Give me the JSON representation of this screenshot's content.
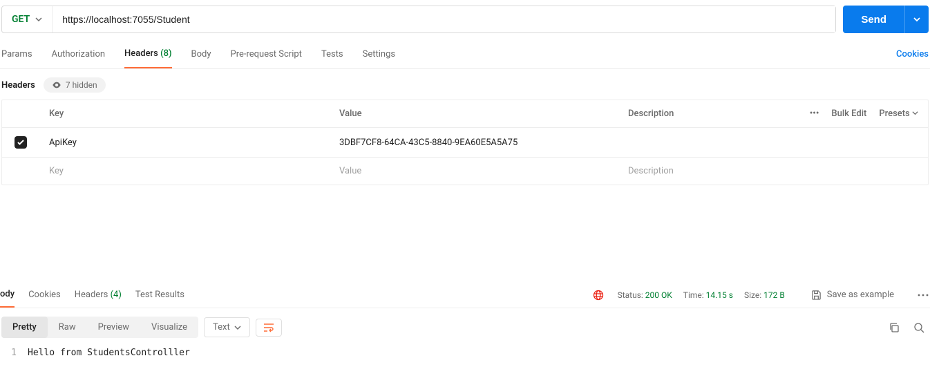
{
  "request": {
    "method": "GET",
    "url": "https://localhost:7055/Student",
    "send_label": "Send"
  },
  "tabs": {
    "params": "Params",
    "auth": "Authorization",
    "headers": "Headers",
    "headers_count": "(8)",
    "body": "Body",
    "prerequest": "Pre-request Script",
    "tests": "Tests",
    "settings": "Settings",
    "cookies": "Cookies"
  },
  "headers_section": {
    "title": "Headers",
    "hidden_label": "7 hidden",
    "col_key": "Key",
    "col_value": "Value",
    "col_desc": "Description",
    "more": "•••",
    "bulk": "Bulk Edit",
    "presets": "Presets",
    "rows": [
      {
        "key": "ApiKey",
        "value": "3DBF7CF8-64CA-43C5-8840-9EA60E5A5A75",
        "desc": ""
      }
    ],
    "ph_key": "Key",
    "ph_value": "Value",
    "ph_desc": "Description"
  },
  "response": {
    "tabs": {
      "body": "ody",
      "cookies": "Cookies",
      "headers": "Headers",
      "headers_count": "(4)",
      "tests": "Test Results"
    },
    "status_label": "Status:",
    "status_value": "200 OK",
    "time_label": "Time:",
    "time_value": "14.15 s",
    "size_label": "Size:",
    "size_value": "172 B",
    "save_example": "Save as example",
    "view_tabs": {
      "pretty": "Pretty",
      "raw": "Raw",
      "preview": "Preview",
      "visualize": "Visualize"
    },
    "format": "Text",
    "lineno": "1",
    "body": "Hello from StudentsControlller"
  }
}
